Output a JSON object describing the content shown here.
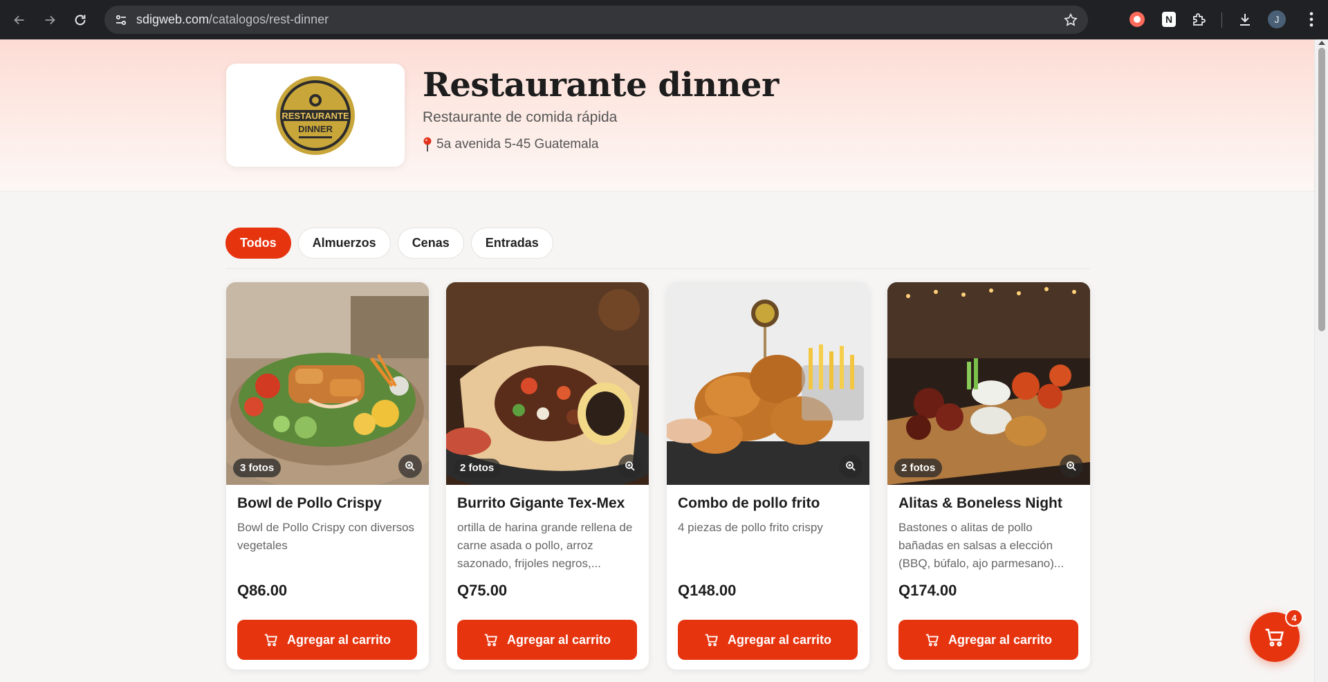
{
  "browser": {
    "url_host": "sdigweb.com",
    "url_path": "/catalogos/rest-dinner",
    "profile_initial": "J",
    "icons": [
      "back-icon",
      "forward-icon",
      "reload-icon",
      "site-info-icon",
      "star-icon",
      "extension-icon",
      "download-icon",
      "menu-icon"
    ]
  },
  "store": {
    "name": "Restaurante dinner",
    "subtitle": "Restaurante de comida rápida",
    "address": "5a avenida 5-45 Guatemala",
    "logo_text_1": "RESTAURANTE",
    "logo_text_2": "DINNER"
  },
  "tabs": [
    {
      "label": "Todos",
      "active": true
    },
    {
      "label": "Almuerzos",
      "active": false
    },
    {
      "label": "Cenas",
      "active": false
    },
    {
      "label": "Entradas",
      "active": false
    }
  ],
  "products": [
    {
      "title": "Bowl de Pollo Crispy",
      "description": "Bowl de Pollo Crispy con diversos vegetales",
      "price": "Q86.00",
      "photos": "3 fotos",
      "button": "Agregar al carrito"
    },
    {
      "title": "Burrito Gigante Tex-Mex",
      "description": "ortilla de harina grande rellena de carne asada o pollo, arroz sazonado, frijoles negros,...",
      "price": "Q75.00",
      "photos": "2 fotos",
      "button": "Agregar al carrito"
    },
    {
      "title": "Combo de pollo frito",
      "description": "4 piezas de pollo frito crispy",
      "price": "Q148.00",
      "photos": "",
      "button": "Agregar al carrito"
    },
    {
      "title": "Alitas & Boneless Night",
      "description": "Bastones o alitas de pollo bañadas en salsas a elección (BBQ, búfalo, ajo parmesano)...",
      "price": "Q174.00",
      "photos": "2 fotos",
      "button": "Agregar al carrito"
    }
  ],
  "cart": {
    "count": "4"
  },
  "colors": {
    "accent": "#e6340f",
    "hero_top": "#fcdcd4",
    "chrome": "#202124"
  }
}
